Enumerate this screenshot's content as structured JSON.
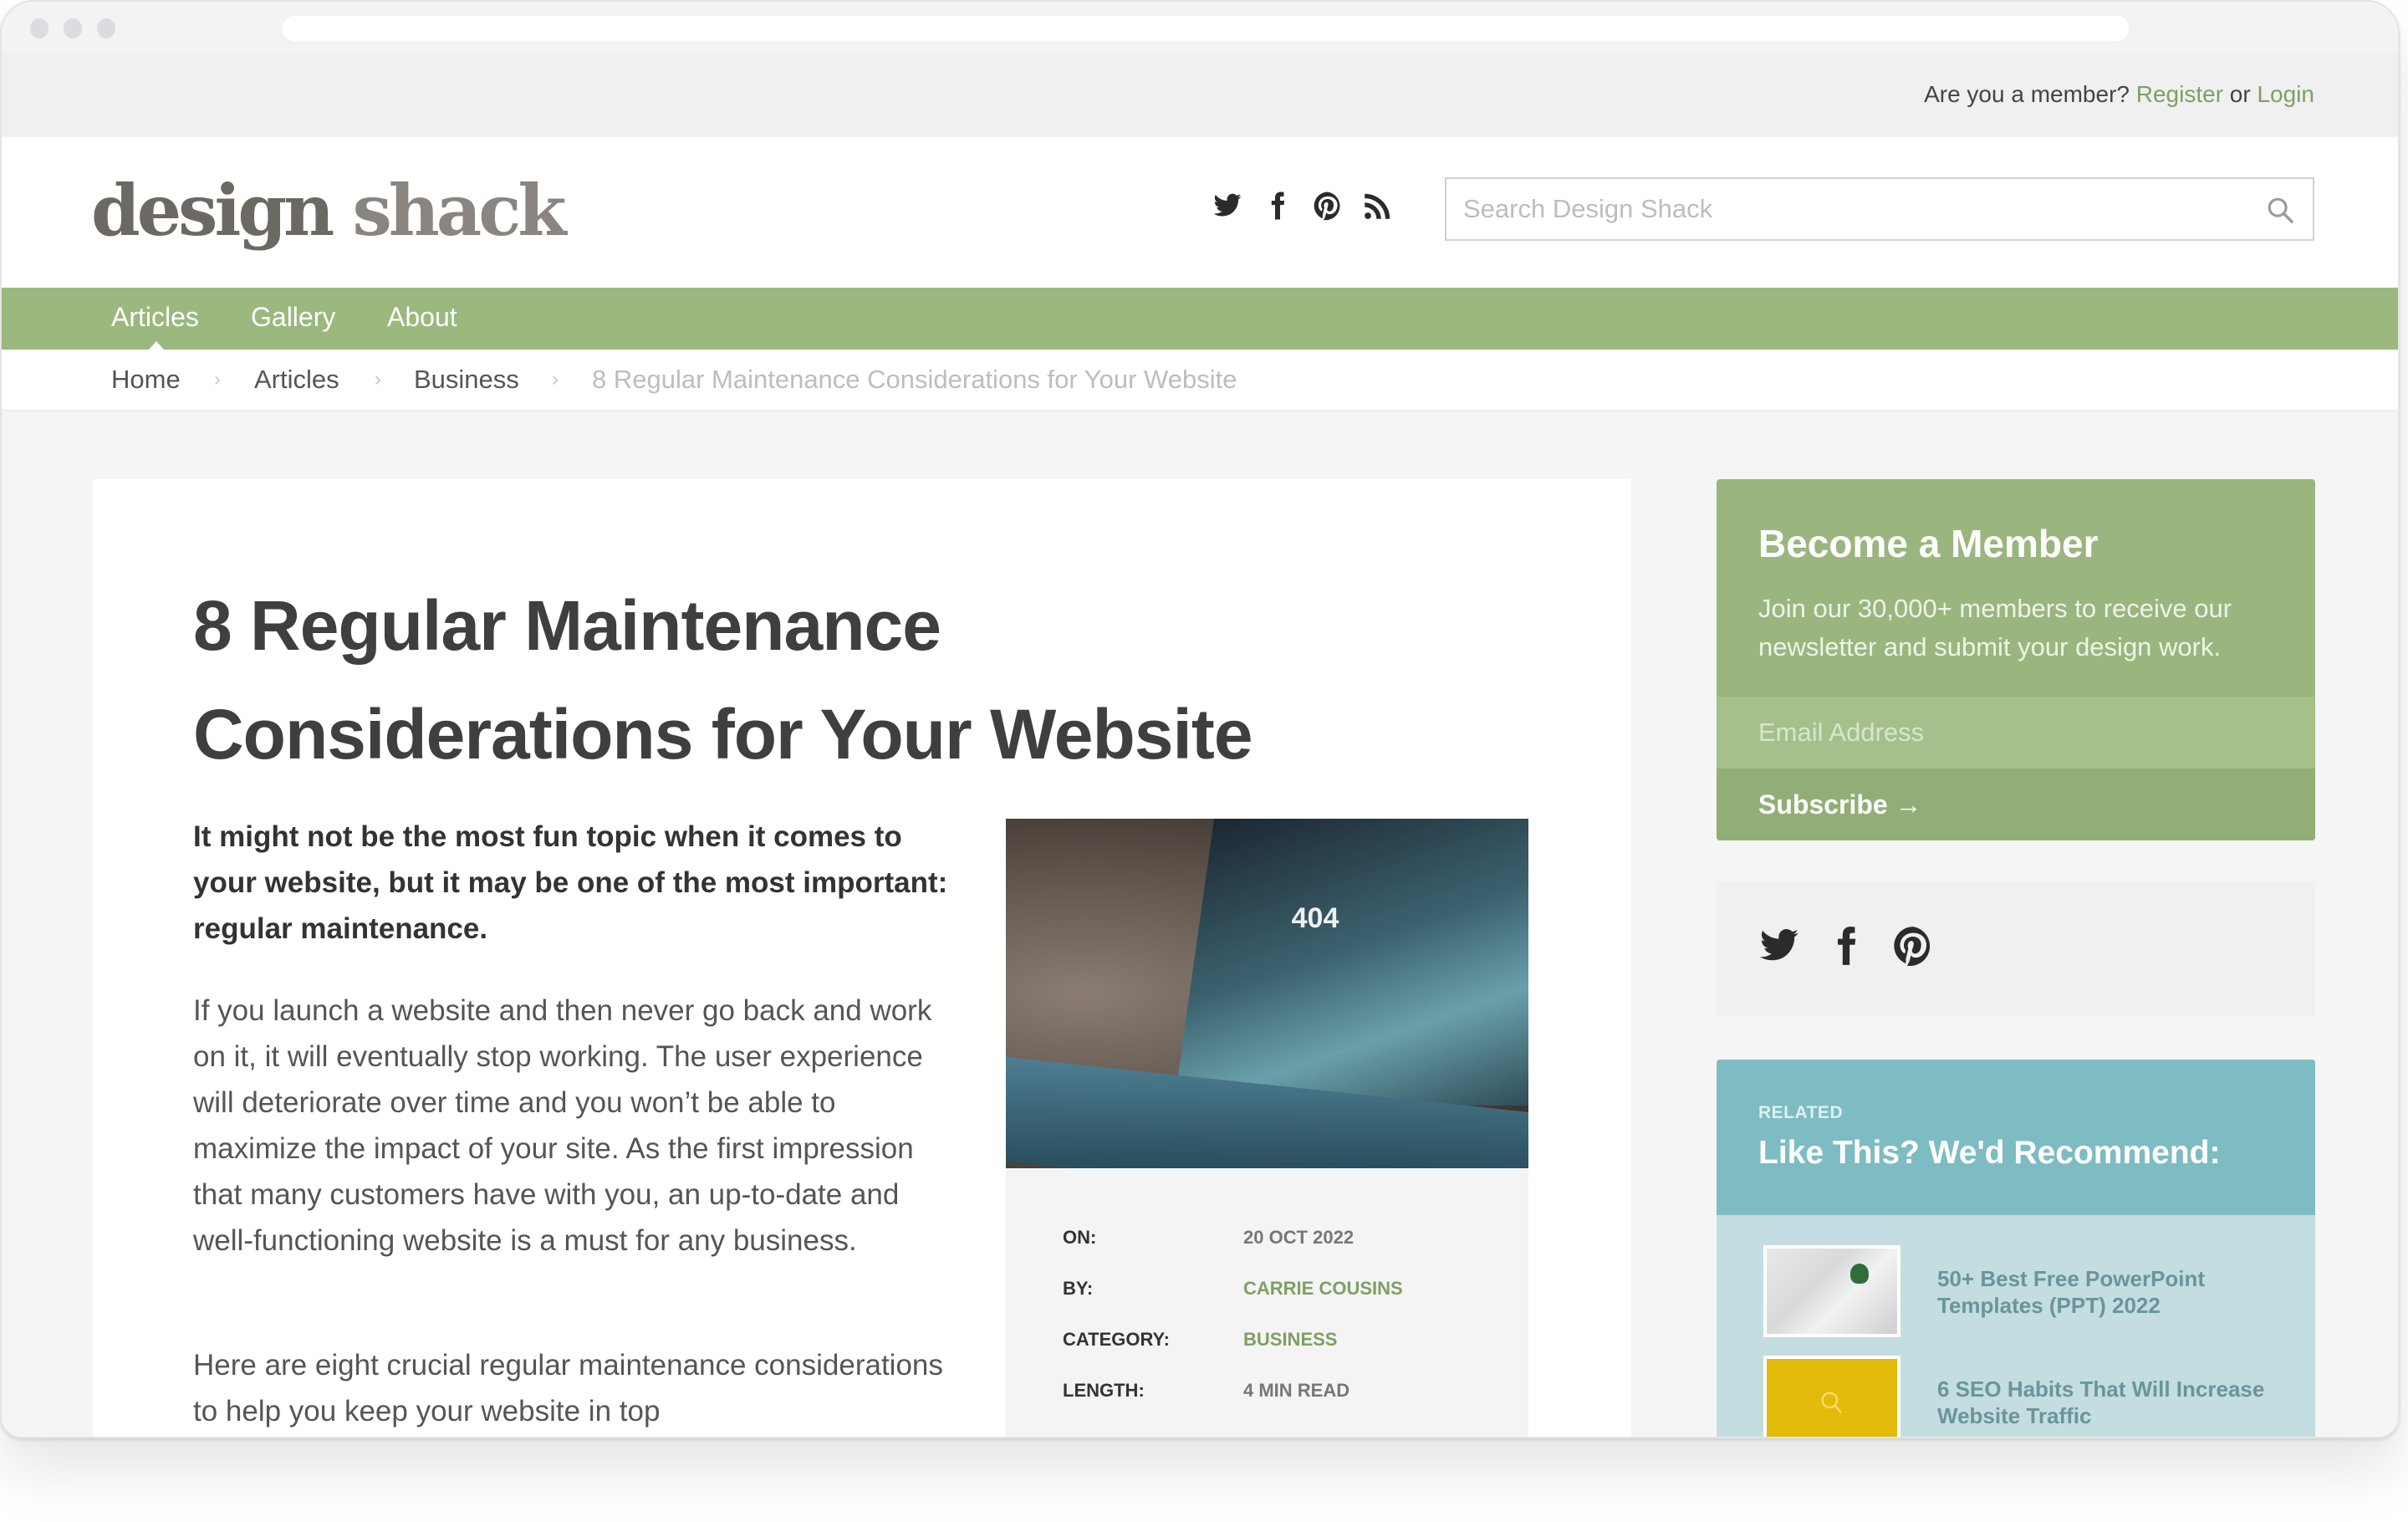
{
  "topbar": {
    "prompt": "Are you a member?",
    "register_label": "Register",
    "or": "or",
    "login_label": "Login"
  },
  "header": {
    "logo_part1": "design",
    "logo_part2": "shack",
    "social_icons": [
      "twitter-icon",
      "facebook-icon",
      "pinterest-icon",
      "rss-icon"
    ],
    "search_placeholder": "Search Design Shack",
    "search_value": ""
  },
  "nav": {
    "items": [
      {
        "label": "Articles",
        "active": true
      },
      {
        "label": "Gallery",
        "active": false
      },
      {
        "label": "About",
        "active": false
      }
    ]
  },
  "breadcrumb": {
    "items": [
      "Home",
      "Articles",
      "Business"
    ],
    "current": "8 Regular Maintenance Considerations for Your Website",
    "separator": "›"
  },
  "article": {
    "title_line1": "8 Regular Maintenance",
    "title_line2": "Considerations for Your Website",
    "lead": "It might not be the most fun topic when it comes to your website, but it may be one of the most important: regular maintenance.",
    "paragraphs": [
      "If you launch a website and then never go back and work on it, it will eventually stop working. The user experience will deteriorate over time and you won’t be able to maximize the impact of your site. As the first impression that many customers have with you, an up-to-date and well-functioning website is a must for any business.",
      "Here are eight crucial regular maintenance considerations to help you keep your website in top"
    ],
    "image_text": "404",
    "meta": [
      {
        "label": "ON:",
        "value": "20 OCT 2022",
        "link": false
      },
      {
        "label": "BY:",
        "value": "CARRIE COUSINS",
        "link": true
      },
      {
        "label": "CATEGORY:",
        "value": "BUSINESS",
        "link": true
      },
      {
        "label": "LENGTH:",
        "value": "4 MIN READ",
        "link": false
      }
    ]
  },
  "sidebar": {
    "member": {
      "title": "Become a Member",
      "text": "Join our 30,000+ members to receive our newsletter and submit your design work.",
      "email_placeholder": "Email Address",
      "email_value": "",
      "subscribe_label": "Subscribe →"
    },
    "social_icons": [
      "twitter-icon",
      "facebook-icon",
      "pinterest-icon"
    ],
    "related": {
      "kicker": "RELATED",
      "title": "Like This? We'd Recommend:",
      "items": [
        {
          "title": "50+ Best Free PowerPoint Templates (PPT) 2022"
        },
        {
          "title": "6 SEO Habits That Will Increase Website Traffic"
        }
      ]
    }
  },
  "colors": {
    "brand_green": "#9bb87e",
    "link_green": "#7f9f63",
    "related_teal": "#7dbcc2",
    "related_bg": "#c3dde0",
    "seo_thumb_yellow": "#e3bc0b"
  }
}
